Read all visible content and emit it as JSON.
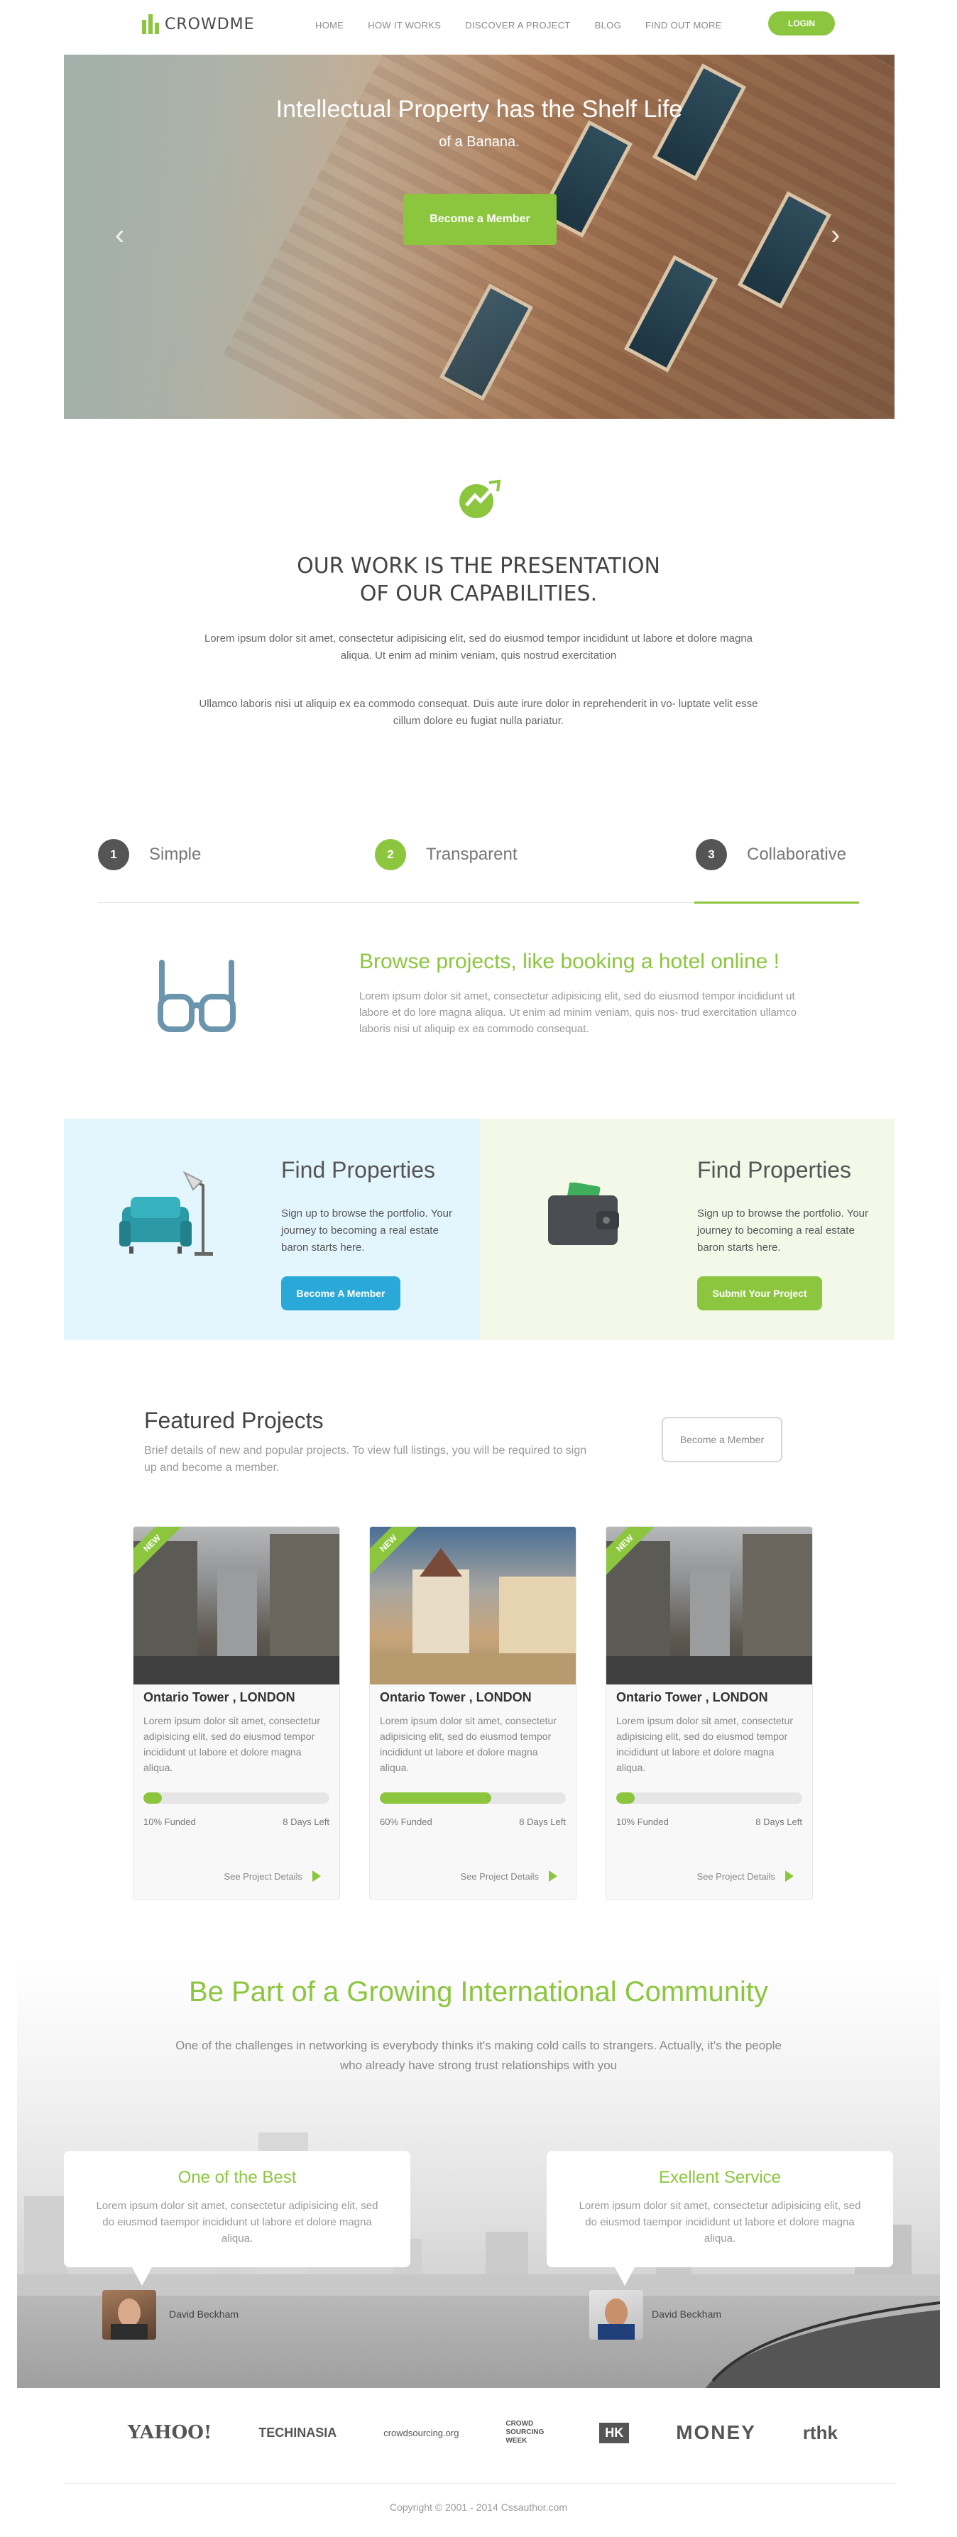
{
  "nav": {
    "brand": "CROWDME",
    "items": [
      "HOME",
      "HOW IT WORKS",
      "DISCOVER A PROJECT",
      "BLOG",
      "FIND OUT MORE"
    ],
    "login": "LOGIN"
  },
  "hero": {
    "title": "Intellectual Property has the Shelf Life",
    "subtitle": "of a Banana.",
    "button": "Become a Member",
    "prev_icon": "chevron-left-icon",
    "next_icon": "chevron-right-icon"
  },
  "capabilities": {
    "title_line1": "OUR WORK IS THE PRESENTATION",
    "title_line2": "OF OUR CAPABILITIES.",
    "p1": "Lorem ipsum dolor sit amet, consectetur adipisicing elit, sed do eiusmod tempor incididunt ut labore et dolore magna aliqua. Ut enim ad minim veniam, quis nostrud exercitation",
    "p2": "Ullamco laboris nisi ut aliquip ex ea commodo consequat. Duis aute irure dolor in reprehenderit in vo- luptate velit esse cillum dolore eu fugiat nulla pariatur."
  },
  "steps": [
    {
      "num": "1",
      "label": "Simple"
    },
    {
      "num": "2",
      "label": "Transparent"
    },
    {
      "num": "3",
      "label": "Collaborative"
    }
  ],
  "browse": {
    "title": "Browse projects, like booking a hotel online !",
    "text": "Lorem ipsum dolor sit amet, consectetur adipisicing elit, sed do eiusmod tempor incididunt ut labore et do lore magna aliqua. Ut enim ad minim veniam, quis nos- trud exercitation ullamco laboris nisi ut aliquip ex ea commodo consequat."
  },
  "properties": [
    {
      "title": "Find Properties",
      "text": "Sign up to browse the portfolio. Your journey to becoming a real estate baron starts here.",
      "button": "Become A Member",
      "color": "#2aa9d9"
    },
    {
      "title": "Find Properties",
      "text": "Sign up to browse the portfolio. Your journey to becoming a real estate baron starts here.",
      "button": "Submit Your Project",
      "color": "#8cc63f"
    }
  ],
  "featured": {
    "title": "Featured Projects",
    "text": "Brief details of new and popular projects. To view full listings, you will be required to sign up and become a member.",
    "button": "Become a Member",
    "cards": [
      {
        "badge": "NEW",
        "name": "Ontario Tower , LONDON",
        "desc": "Lorem ipsum dolor sit amet, consectetur adipisicing elit, sed do eiusmod tempor incididunt ut labore et dolore magna aliqua.",
        "funded_label": "10% Funded",
        "funded": 0.1,
        "days": "8 Days Left",
        "link": "See Project Details"
      },
      {
        "badge": "NEW",
        "name": "Ontario Tower , LONDON",
        "desc": "Lorem ipsum dolor sit amet, consectetur adipisicing elit, sed do eiusmod tempor incididunt ut labore et dolore magna aliqua.",
        "funded_label": "60% Funded",
        "funded": 0.6,
        "days": "8 Days Left",
        "link": "See Project Details"
      },
      {
        "badge": "NEW",
        "name": "Ontario Tower , LONDON",
        "desc": "Lorem ipsum dolor sit amet, consectetur adipisicing elit, sed do eiusmod tempor incididunt ut labore et dolore magna aliqua.",
        "funded_label": "10% Funded",
        "funded": 0.1,
        "days": "8 Days Left",
        "link": "See Project Details"
      }
    ]
  },
  "community": {
    "title": "Be Part of a Growing International Community",
    "text": "One of the challenges in networking is everybody thinks it's making cold calls to strangers. Actually, it's the people who already have strong trust relationships with you",
    "testimonials": [
      {
        "title": "One of the Best",
        "text": "Lorem ipsum dolor sit amet, consectetur adipisicing elit, sed do eiusmod taempor incididunt ut labore et dolore magna aliqua.",
        "name": "David Beckham"
      },
      {
        "title": "Exellent Service",
        "text": "Lorem ipsum dolor sit amet, consectetur adipisicing elit, sed do eiusmod taempor incididunt ut labore et dolore magna aliqua.",
        "name": "David Beckham"
      }
    ]
  },
  "partners": [
    "YAHOO!",
    "TECHINASIA",
    "crowdsourcing.org",
    "CROWD SOURCING WEEK",
    "HK",
    "MONEY",
    "rthk"
  ],
  "footer": {
    "copyright": "Copyright © 2001 - 2014 Cssauthor.com"
  }
}
